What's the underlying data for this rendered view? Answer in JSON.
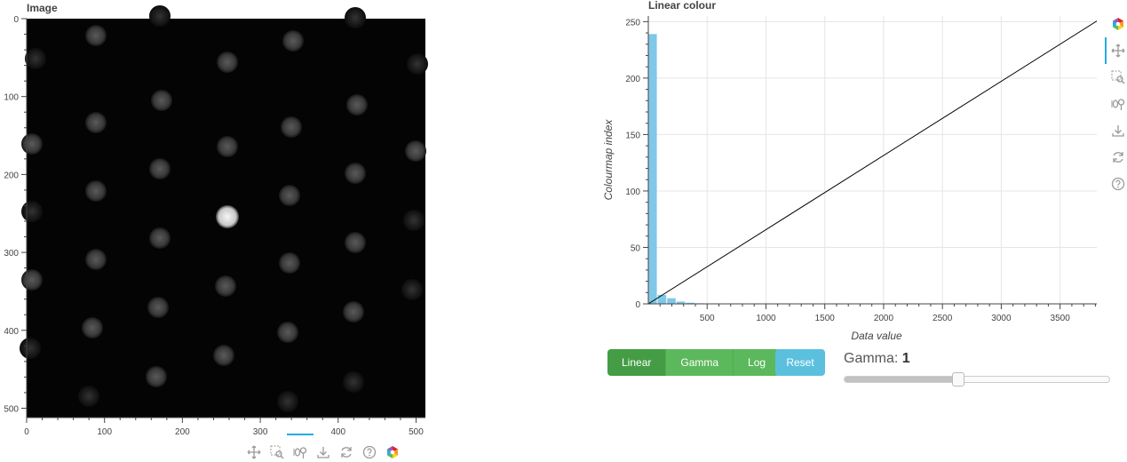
{
  "image_panel": {
    "title": "Image",
    "x_ticks": [
      "0",
      "100",
      "200",
      "300",
      "400",
      "500"
    ],
    "y_ticks": [
      "0",
      "100",
      "200",
      "300",
      "400",
      "500"
    ],
    "x_range": [
      0,
      512
    ],
    "y_range": [
      0,
      512
    ]
  },
  "chart_data": {
    "type": "bar",
    "title": "Linear colour",
    "xlabel": "Data value",
    "ylabel": "Colourmap index",
    "x_ticks": [
      "500",
      "1000",
      "1500",
      "2000",
      "2500",
      "3000",
      "3500"
    ],
    "y_ticks": [
      "0",
      "50",
      "100",
      "150",
      "200",
      "250"
    ],
    "xlim": [
      0,
      3880
    ],
    "ylim": [
      0,
      255
    ],
    "grid": true,
    "histogram": {
      "bin_edges": [
        0,
        80,
        160,
        240,
        320,
        400,
        480,
        560,
        640,
        720,
        800,
        880,
        960,
        1040,
        1120,
        1200
      ],
      "counts": [
        239,
        8,
        5,
        2,
        1,
        0.5,
        0.4,
        0.3,
        0.3,
        0.2,
        0.2,
        0.2,
        0.2,
        0.1,
        0.1
      ],
      "color": "#7fc8e8"
    },
    "mapping_line": {
      "x": [
        0,
        3880
      ],
      "y": [
        0,
        255
      ],
      "color": "#000000"
    }
  },
  "controls": {
    "mode_buttons": [
      "Linear",
      "Gamma",
      "Log"
    ],
    "active_mode": "Linear",
    "reset_label": "Reset",
    "gamma_label": "Gamma:",
    "gamma_value": "1",
    "gamma_fraction": 0.43
  },
  "toolbar_icons": [
    "pan-icon",
    "box-zoom-icon",
    "wheel-zoom-icon",
    "save-icon",
    "reset-icon",
    "help-icon",
    "bokeh-logo-icon"
  ]
}
